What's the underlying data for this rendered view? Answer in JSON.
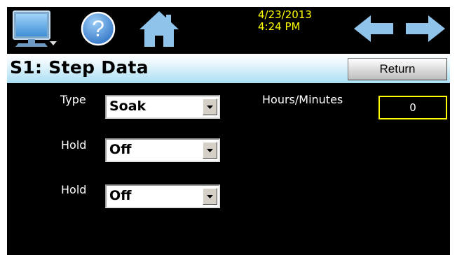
{
  "header": {
    "date": "4/23/2013",
    "time": "4:24 PM",
    "icons": [
      "monitor-icon",
      "help-icon",
      "home-icon",
      "back-arrow-icon",
      "forward-arrow-icon"
    ]
  },
  "page": {
    "title": "S1: Step Data",
    "return_label": "Return"
  },
  "form": {
    "type_label": "Type",
    "type_value": "Soak",
    "hold1_label": "Hold",
    "hold1_value": "Off",
    "hold2_label": "Hold",
    "hold2_value": "Off",
    "hours_minutes_label": "Hours/Minutes",
    "hours_minutes_value": "0"
  },
  "colors": {
    "background": "#000000",
    "datetime": "#ffff00",
    "title_gradient_end": "#a9def3",
    "input_border_highlight": "#ffff00"
  }
}
